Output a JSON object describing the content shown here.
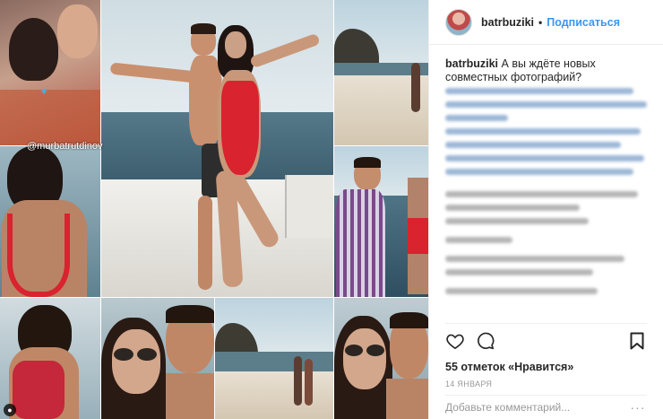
{
  "post": {
    "username": "batrbuziki",
    "separator": "•",
    "follow_label": "Подписаться",
    "watermark": "@murbatrutdinov",
    "caption_username": "batrbuziki",
    "caption_text": "А вы ждёте новых совместных фотографий?",
    "likes_text": "55 отметок «Нравится»",
    "date_text": "14 ЯНВАРЯ",
    "comment_placeholder": "Добавьте комментарий...",
    "more_label": "···"
  },
  "icons": {
    "like": "heart-icon",
    "comment": "comment-icon",
    "save": "bookmark-icon",
    "more": "more-options-icon"
  },
  "colors": {
    "link_blue": "#3897f0",
    "text": "#262626",
    "muted": "#999999",
    "divider": "#efefef",
    "swimsuit_red": "#d9232e"
  }
}
